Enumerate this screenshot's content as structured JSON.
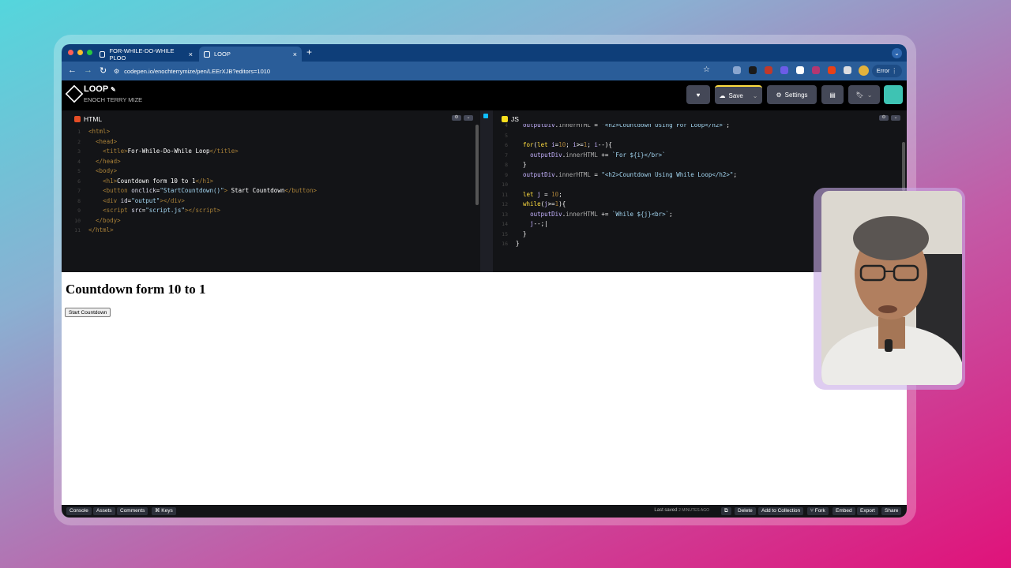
{
  "browser": {
    "tabs": [
      {
        "label": "FOR-WHILE-DO-WHILE PLOO"
      },
      {
        "label": "LOOP"
      }
    ],
    "url": "codepen.io/enochterrymize/pen/LEErXJB?editors=1010",
    "error_label": "Error"
  },
  "header": {
    "title": "LOOP",
    "author": "ENOCH TERRY MIZE",
    "save_label": "Save",
    "settings_label": "Settings"
  },
  "html_pane": {
    "label": "HTML",
    "line_numbers": [
      "1",
      "2",
      "3",
      "4",
      "5",
      "6",
      "7",
      "8",
      "9",
      "10",
      "11"
    ]
  },
  "js_pane": {
    "label": "JS",
    "line_numbers": [
      "4",
      "5",
      "6",
      "7",
      "8",
      "9",
      "10",
      "11",
      "12",
      "13",
      "14",
      "15",
      "16"
    ]
  },
  "preview": {
    "heading": "Countdown form 10 to 1",
    "button_label": "Start Countdown"
  },
  "footer": {
    "console": "Console",
    "assets": "Assets",
    "comments": "Comments",
    "keys": "⌘ Keys",
    "last_saved_prefix": "Last saved",
    "last_saved_value": "2 MINUTES AGO",
    "delete": "Delete",
    "add_to_collection": "Add to Collection",
    "fork": "Fork",
    "embed": "Embed",
    "export": "Export",
    "share": "Share"
  },
  "colors": {
    "tab_bar": "#0e3e79",
    "address_bar": "#2a5d99",
    "editor_bg": "#131417"
  }
}
